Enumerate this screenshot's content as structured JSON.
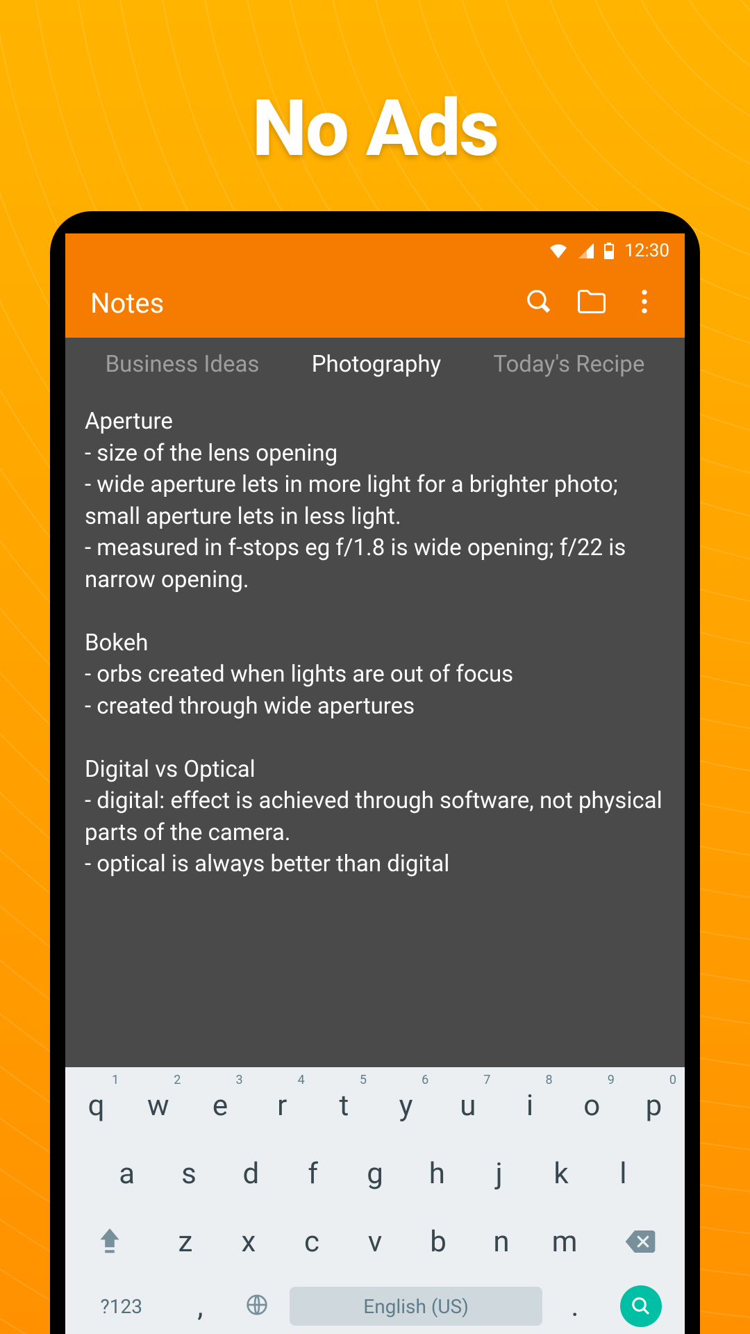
{
  "promo": {
    "title": "No Ads"
  },
  "statusbar": {
    "time": "12:30"
  },
  "appbar": {
    "title": "Notes"
  },
  "tabs": {
    "items": [
      {
        "label": "Business Ideas",
        "active": false
      },
      {
        "label": "Photography",
        "active": true
      },
      {
        "label": "Today's Recipe",
        "active": false
      }
    ]
  },
  "note": {
    "content": "Aperture\n- size of the lens opening\n- wide aperture lets in more light for a brighter photo; small aperture lets in less light.\n- measured in f-stops eg f/1.8 is wide opening; f/22 is narrow opening.\n\nBokeh\n- orbs created when lights are out of focus\n- created through wide apertures\n\nDigital vs Optical\n- digital: effect is achieved through software, not physical parts of the camera.\n- optical is always better than digital"
  },
  "keyboard": {
    "row1": [
      {
        "k": "q",
        "h": "1"
      },
      {
        "k": "w",
        "h": "2"
      },
      {
        "k": "e",
        "h": "3"
      },
      {
        "k": "r",
        "h": "4"
      },
      {
        "k": "t",
        "h": "5"
      },
      {
        "k": "y",
        "h": "6"
      },
      {
        "k": "u",
        "h": "7"
      },
      {
        "k": "i",
        "h": "8"
      },
      {
        "k": "o",
        "h": "9"
      },
      {
        "k": "p",
        "h": "0"
      }
    ],
    "row2": [
      "a",
      "s",
      "d",
      "f",
      "g",
      "h",
      "j",
      "k",
      "l"
    ],
    "row3": [
      "z",
      "x",
      "c",
      "v",
      "b",
      "n",
      "m"
    ],
    "fn_label": "?123",
    "comma": ",",
    "dot": ".",
    "space_label": "English (US)"
  },
  "colors": {
    "accent": "#F57C00",
    "bg_dark": "#4a4a4a",
    "kb_bg": "#ECEFF1",
    "kb_action": "#00BFA5"
  }
}
